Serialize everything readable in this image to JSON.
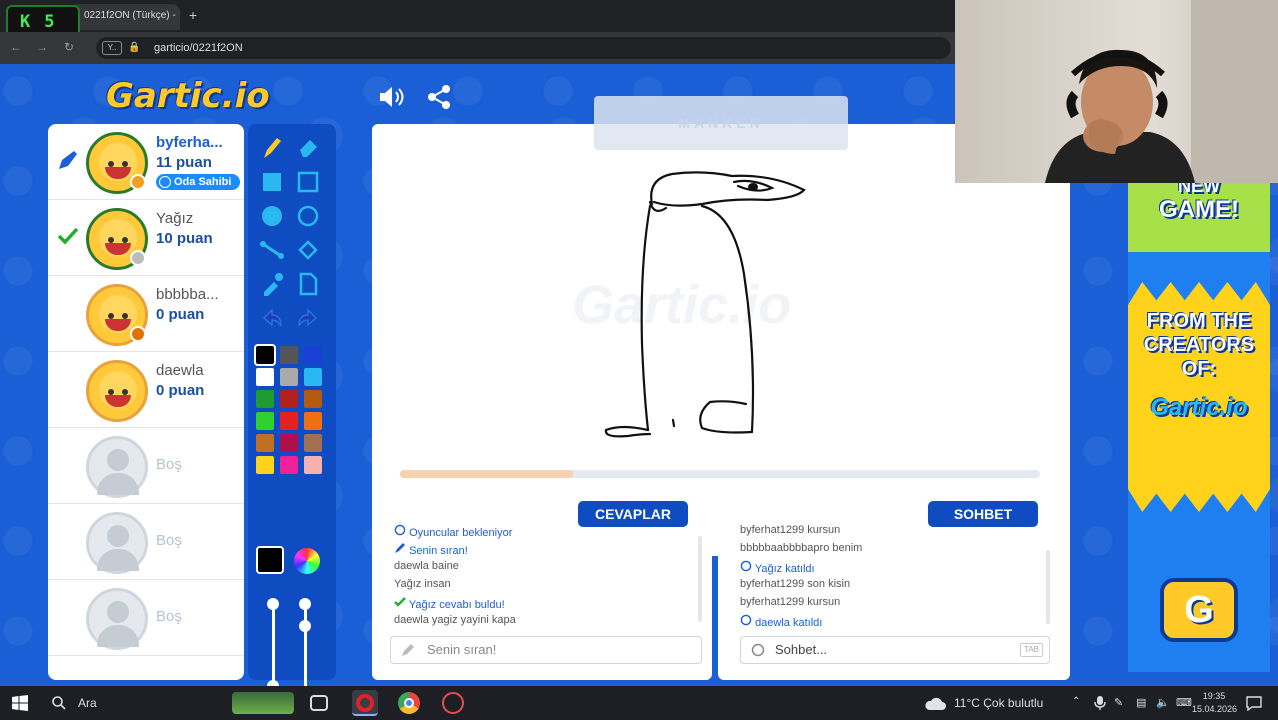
{
  "browser": {
    "tab_title": "0221f2ON (Türkçe) -",
    "url": "garticio/0221f2ON",
    "site_badge": "Y..",
    "overlay_badge": {
      "left": "K",
      "right": "5"
    }
  },
  "game": {
    "logo": "Gartic.io",
    "word_hint": "MANKEN",
    "canvas_watermark": "Gartic.io",
    "round_progress": 0.27
  },
  "players": [
    {
      "name": "byferha...",
      "score": "11 puan",
      "badge": "Oda Sahibi",
      "status": "drawing",
      "dot_color": "#f0a020"
    },
    {
      "name": "Yağız",
      "score": "10 puan",
      "badge": "",
      "status": "guessed",
      "dot_color": "#bdbdbd"
    },
    {
      "name": "bbbbba...",
      "score": "0 puan",
      "badge": "",
      "status": "",
      "dot_color": "#e07000"
    },
    {
      "name": "daewla",
      "score": "0 puan",
      "badge": "",
      "status": "",
      "dot_color": ""
    },
    {
      "name": "Boş"
    },
    {
      "name": "Boş"
    },
    {
      "name": "Boş"
    }
  ],
  "colors": {
    "palette": [
      "#000000",
      "#555555",
      "#1a3fd6",
      "#ffffff",
      "#aaaaaa",
      "#2ab8f0",
      "#1f9a2e",
      "#b32020",
      "#b35a10",
      "#2ed12e",
      "#e52020",
      "#f07010",
      "#c07020",
      "#b0104a",
      "#a07050",
      "#ffd21c",
      "#f0209a",
      "#f5b0b0"
    ],
    "current": "#000000",
    "accent": "#1a5fd6"
  },
  "answers": {
    "header": "CEVAPLAR",
    "messages": [
      {
        "text": "Oyuncular bekleniyor",
        "style": "blue",
        "icon": "info"
      },
      {
        "text": "Senin sıran!",
        "style": "blue",
        "icon": "pencil"
      },
      {
        "text": "daewla baine",
        "style": "",
        "icon": ""
      },
      {
        "text": "Yağız insan",
        "style": "",
        "icon": ""
      },
      {
        "text": "Yağız cevabı buldu!",
        "style": "green",
        "icon": "check"
      },
      {
        "text": "daewla yagiz yayini kapa",
        "style": "",
        "icon": ""
      }
    ],
    "input_placeholder": "Senin sıran!"
  },
  "chat": {
    "header": "SOHBET",
    "messages": [
      {
        "text": "byferhat1299 kursun",
        "style": "",
        "icon": ""
      },
      {
        "text": "bbbbbaabbbbapro benim",
        "style": "",
        "icon": ""
      },
      {
        "text": "Yağız katıldı",
        "style": "blue",
        "icon": "info"
      },
      {
        "text": "byferhat1299 son kisin",
        "style": "",
        "icon": ""
      },
      {
        "text": "byferhat1299 kursun",
        "style": "",
        "icon": ""
      },
      {
        "text": "daewla katıldı",
        "style": "blue",
        "icon": "info"
      }
    ],
    "input_placeholder": "Sohbet...",
    "input_hint": "TAB"
  },
  "ad": {
    "line1": "NEW",
    "line2": "GAME!",
    "line3": "FROM THE",
    "line4": "CREATORS",
    "line5": "OF:",
    "logo": "Gartic.io",
    "button": "G"
  },
  "taskbar": {
    "search": "Ara",
    "weather": "11°C  Çok bulutlu",
    "time": "19:35",
    "date": "15.04.2026"
  }
}
